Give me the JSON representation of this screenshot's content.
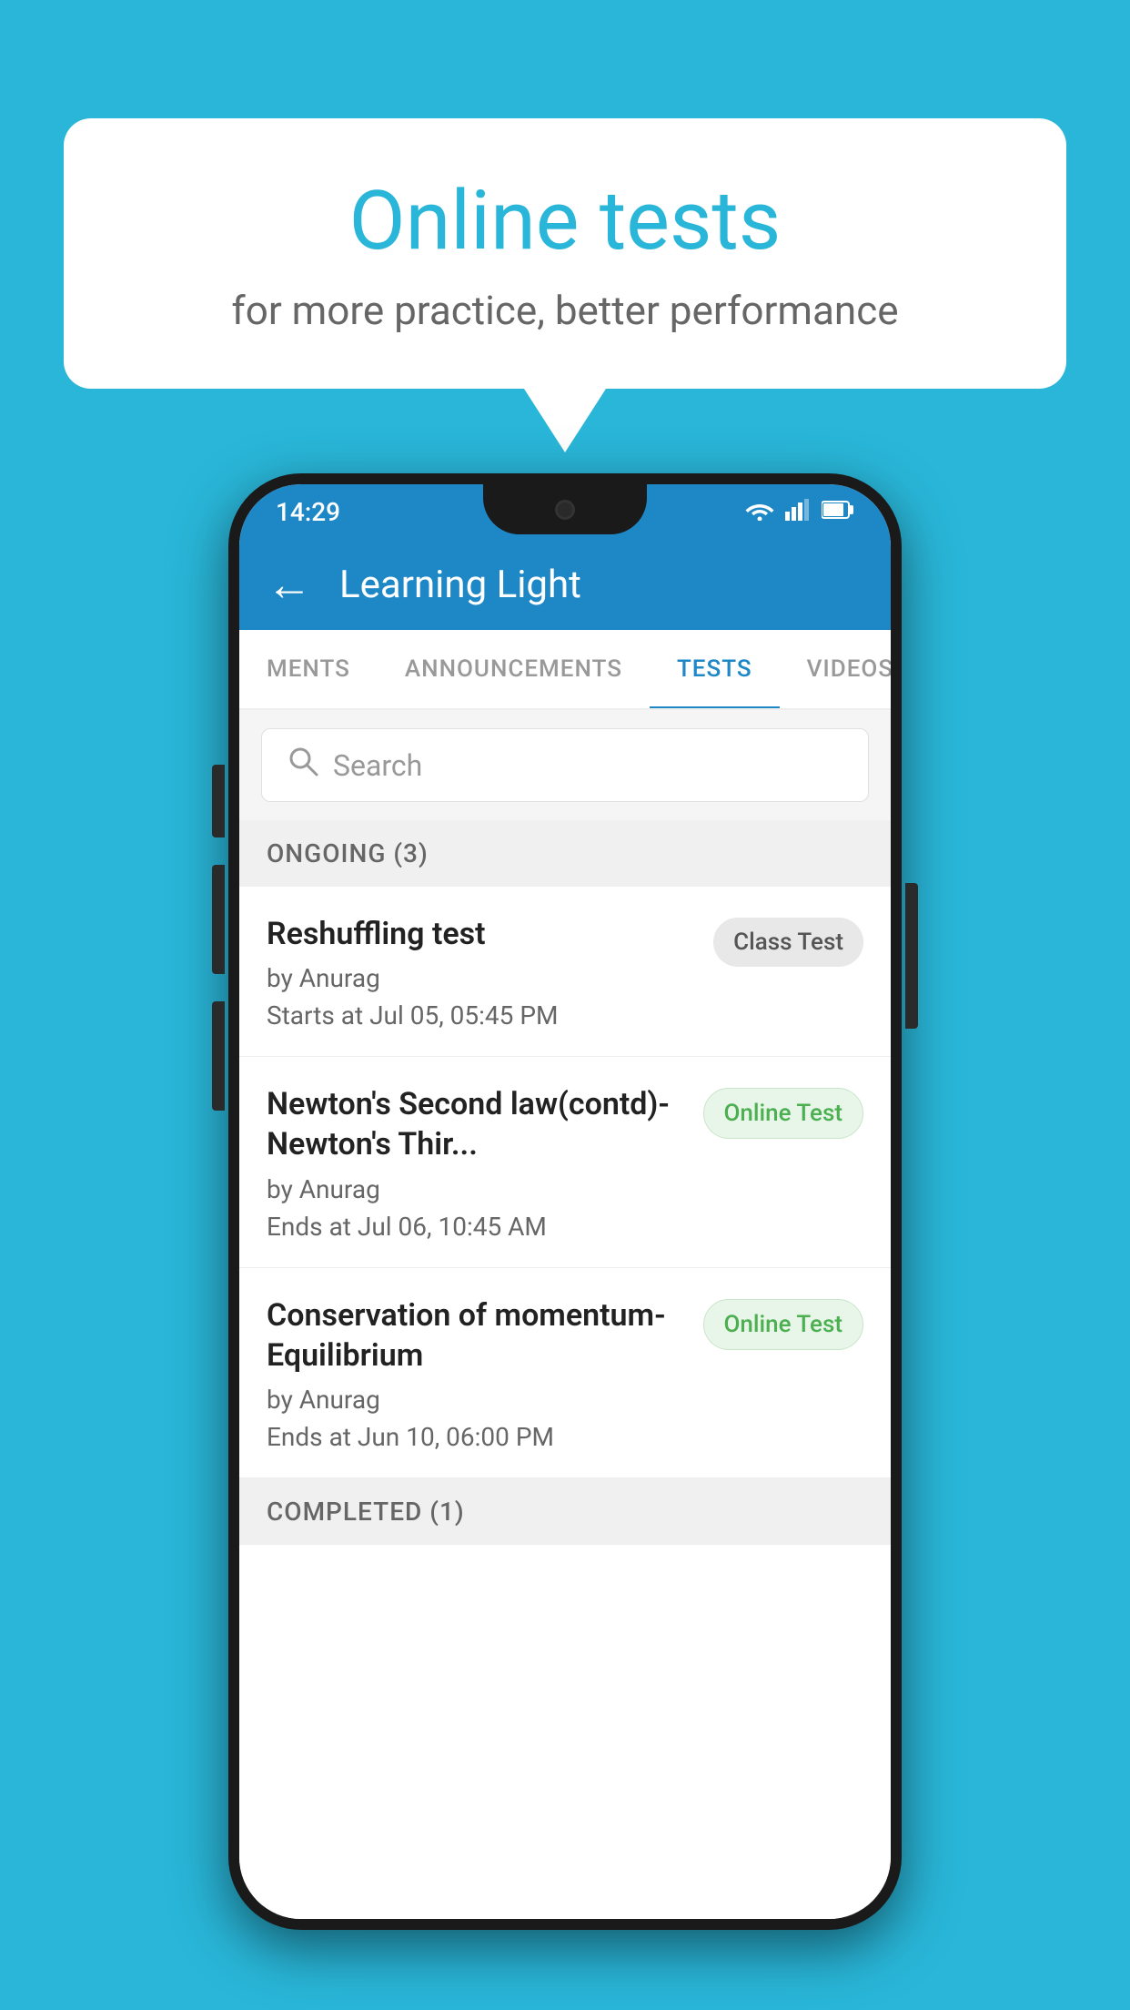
{
  "background": {
    "color": "#29B6D8"
  },
  "speech_bubble": {
    "title": "Online tests",
    "subtitle": "for more practice, better performance"
  },
  "phone": {
    "status_bar": {
      "time": "14:29",
      "wifi_icon": "▾",
      "signal_icon": "◂▴",
      "battery_icon": "▮"
    },
    "app_header": {
      "back_label": "←",
      "title": "Learning Light"
    },
    "tabs": [
      {
        "label": "MENTS",
        "active": false
      },
      {
        "label": "ANNOUNCEMENTS",
        "active": false
      },
      {
        "label": "TESTS",
        "active": true
      },
      {
        "label": "VIDEOS",
        "active": false
      }
    ],
    "search": {
      "placeholder": "Search"
    },
    "ongoing_section": {
      "label": "ONGOING (3)"
    },
    "tests": [
      {
        "name": "Reshuffling test",
        "author": "by Anurag",
        "date_label": "Starts at",
        "date": "Jul 05, 05:45 PM",
        "badge": "Class Test",
        "badge_type": "class"
      },
      {
        "name": "Newton's Second law(contd)-Newton's Thir...",
        "author": "by Anurag",
        "date_label": "Ends at",
        "date": "Jul 06, 10:45 AM",
        "badge": "Online Test",
        "badge_type": "online"
      },
      {
        "name": "Conservation of momentum-Equilibrium",
        "author": "by Anurag",
        "date_label": "Ends at",
        "date": "Jun 10, 06:00 PM",
        "badge": "Online Test",
        "badge_type": "online"
      }
    ],
    "completed_section": {
      "label": "COMPLETED (1)"
    }
  }
}
